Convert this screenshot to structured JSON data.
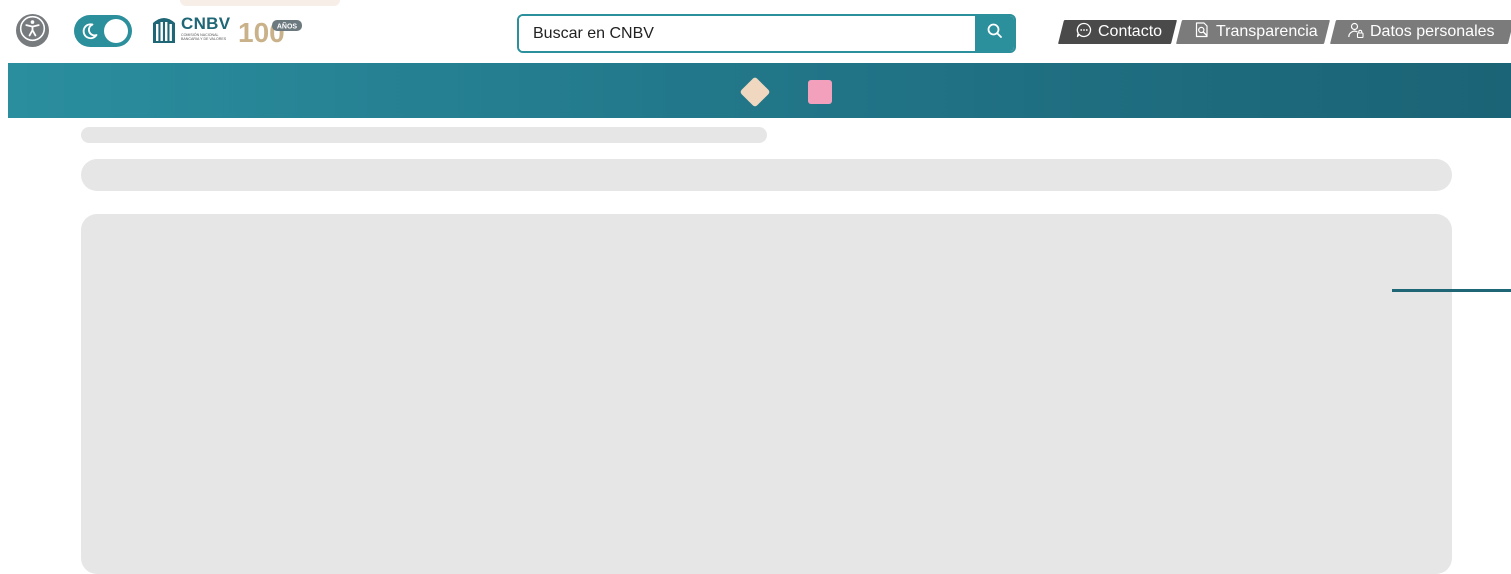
{
  "header": {
    "accessibility_icon": "accessibility-icon",
    "mode_toggle_icon": "moon-icon",
    "logo": {
      "brand": "CNBV",
      "subtitle": "Comisión Nacional Bancaria y de Valores",
      "anniversary_number": "100",
      "anniversary_word": "AÑOS"
    },
    "search": {
      "placeholder": "Buscar en CNBV",
      "icon": "search-icon"
    },
    "quicklinks": [
      {
        "label": "Contacto",
        "icon": "chat-bubble-icon"
      },
      {
        "label": "Transparencia",
        "icon": "document-search-icon"
      },
      {
        "label": "Datos personales",
        "icon": "user-lock-icon"
      }
    ]
  },
  "colors": {
    "accent": "#2c8f9c",
    "banner_start": "#2a8e9e",
    "banner_end": "#1b6376",
    "contacto_bg": "#4a4a4a",
    "link_bg": "#7b7b7b",
    "skeleton": "#e6e6e6",
    "diamond": "#f0d8c0",
    "square": "#f2a0bc"
  }
}
